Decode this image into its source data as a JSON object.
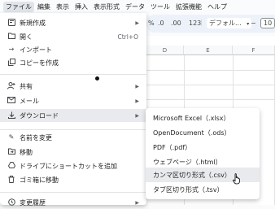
{
  "menubar": {
    "items": [
      "ファイル",
      "編集",
      "表示",
      "挿入",
      "表示形式",
      "データ",
      "ツール",
      "拡張機能",
      "ヘルプ"
    ]
  },
  "toolbar": {
    "percent": "%",
    "decimal_less": ".0",
    "decimal_more": ".00",
    "number_format": "123",
    "font_name": "デフォル...",
    "font_size": "10"
  },
  "columns": [
    "D",
    "E",
    "F"
  ],
  "file_menu": {
    "items": [
      {
        "label": "新規作成",
        "icon": "new-icon",
        "submenu": true
      },
      {
        "label": "開く",
        "icon": "open-folder-icon",
        "shortcut": "Ctrl+O"
      },
      {
        "label": "インポート",
        "icon": "import-icon"
      },
      {
        "label": "コピーを作成",
        "icon": "copy-icon"
      },
      {
        "label": "共有",
        "icon": "share-person-icon",
        "submenu": true
      },
      {
        "label": "メール",
        "icon": "mail-icon",
        "submenu": true
      },
      {
        "label": "ダウンロード",
        "icon": "download-icon",
        "submenu": true
      },
      {
        "label": "名前を変更",
        "icon": "rename-pencil-icon"
      },
      {
        "label": "移動",
        "icon": "move-folder-icon"
      },
      {
        "label": "ドライブにショートカットを追加",
        "icon": "drive-shortcut-icon"
      },
      {
        "label": "ゴミ箱に移動",
        "icon": "trash-icon"
      },
      {
        "label": "変更履歴",
        "icon": "history-icon",
        "submenu": true
      }
    ]
  },
  "download_submenu": {
    "items": [
      "Microsoft Excel（.xlsx）",
      "OpenDocument（.ods）",
      "PDF（.pdf）",
      "ウェブページ（.html）",
      "カンマ区切り形式（.csv）",
      "タブ区切り形式（.tsv）"
    ]
  }
}
